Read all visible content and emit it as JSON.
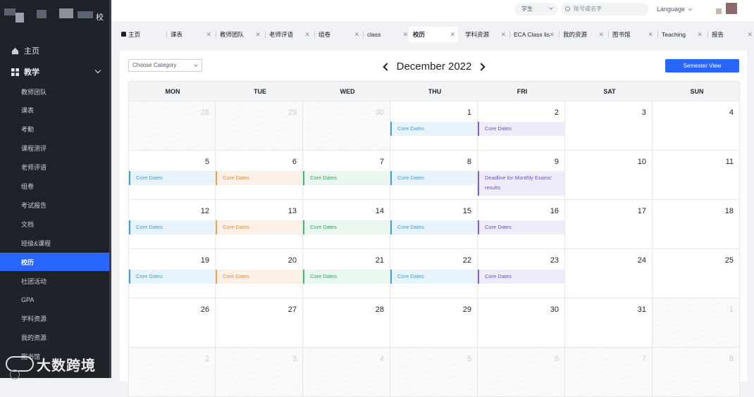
{
  "sidebar": {
    "brand_suffix": "校",
    "home": "主页",
    "section": "教学",
    "items": [
      "教师团队",
      "课表",
      "考勤",
      "课程测评",
      "老师评语",
      "组卷",
      "考试报告",
      "文档",
      "班级&课程",
      "校历",
      "社团活动",
      "GPA",
      "学科资源",
      "我的资源",
      "图书馆"
    ],
    "active_index": 9,
    "watermark": "大数跨境"
  },
  "header": {
    "role": "学生",
    "search_placeholder": "账号或名字",
    "language": "Language"
  },
  "tabs": [
    "主页",
    "课表",
    "教师团队",
    "老师评语",
    "组卷",
    "class",
    "校历",
    "学科资源",
    "ECA Class lis",
    "我的资源",
    "图书馆",
    "Teaching",
    "报告"
  ],
  "active_tab": 6,
  "toolbar": {
    "category_placeholder": "Choose Category",
    "month_title": "December 2022",
    "semester_button": "Semester View"
  },
  "calendar": {
    "weekdays": [
      "MON",
      "TUE",
      "WED",
      "THU",
      "FRI",
      "SAT",
      "SUN"
    ],
    "weeks": [
      [
        {
          "d": "28",
          "o": true
        },
        {
          "d": "29",
          "o": true
        },
        {
          "d": "30",
          "o": true
        },
        {
          "d": "1",
          "e": "Core Dates",
          "c": "blue"
        },
        {
          "d": "2",
          "e": "Core Dates",
          "c": "purple"
        },
        {
          "d": "3"
        },
        {
          "d": "4"
        }
      ],
      [
        {
          "d": "5",
          "e": "Core Dates",
          "c": "blue"
        },
        {
          "d": "6",
          "e": "Core Dates",
          "c": "orange"
        },
        {
          "d": "7",
          "e": "Core Dates",
          "c": "green"
        },
        {
          "d": "8",
          "e": "Core Dates",
          "c": "blue"
        },
        {
          "d": "9",
          "e": "Deadline for Monthly Exams' results",
          "c": "purple",
          "tall": true
        },
        {
          "d": "10"
        },
        {
          "d": "11"
        }
      ],
      [
        {
          "d": "12",
          "e": "Core Dates",
          "c": "blue"
        },
        {
          "d": "13",
          "e": "Core Dates",
          "c": "orange"
        },
        {
          "d": "14",
          "e": "Core Dates",
          "c": "green"
        },
        {
          "d": "15",
          "e": "Core Dates",
          "c": "blue"
        },
        {
          "d": "16",
          "e": "Core Dates",
          "c": "purple"
        },
        {
          "d": "17"
        },
        {
          "d": "18"
        }
      ],
      [
        {
          "d": "19",
          "e": "Core Dates",
          "c": "blue"
        },
        {
          "d": "20",
          "e": "Core Dates",
          "c": "orange"
        },
        {
          "d": "21",
          "e": "Core Dates",
          "c": "green"
        },
        {
          "d": "22",
          "e": "Core Dates",
          "c": "blue"
        },
        {
          "d": "23",
          "e": "Core Dates",
          "c": "purple"
        },
        {
          "d": "24"
        },
        {
          "d": "25"
        }
      ],
      [
        {
          "d": "26"
        },
        {
          "d": "27"
        },
        {
          "d": "28"
        },
        {
          "d": "29"
        },
        {
          "d": "30"
        },
        {
          "d": "31"
        },
        {
          "d": "1",
          "o": true
        }
      ],
      [
        {
          "d": "2",
          "o": true
        },
        {
          "d": "3",
          "o": true
        },
        {
          "d": "4",
          "o": true
        },
        {
          "d": "5",
          "o": true
        },
        {
          "d": "6",
          "o": true
        },
        {
          "d": "7",
          "o": true
        },
        {
          "d": "8",
          "o": true
        }
      ]
    ]
  },
  "colors": {
    "accent": "#2867ff",
    "sidebar_bg": "#1f2329"
  }
}
